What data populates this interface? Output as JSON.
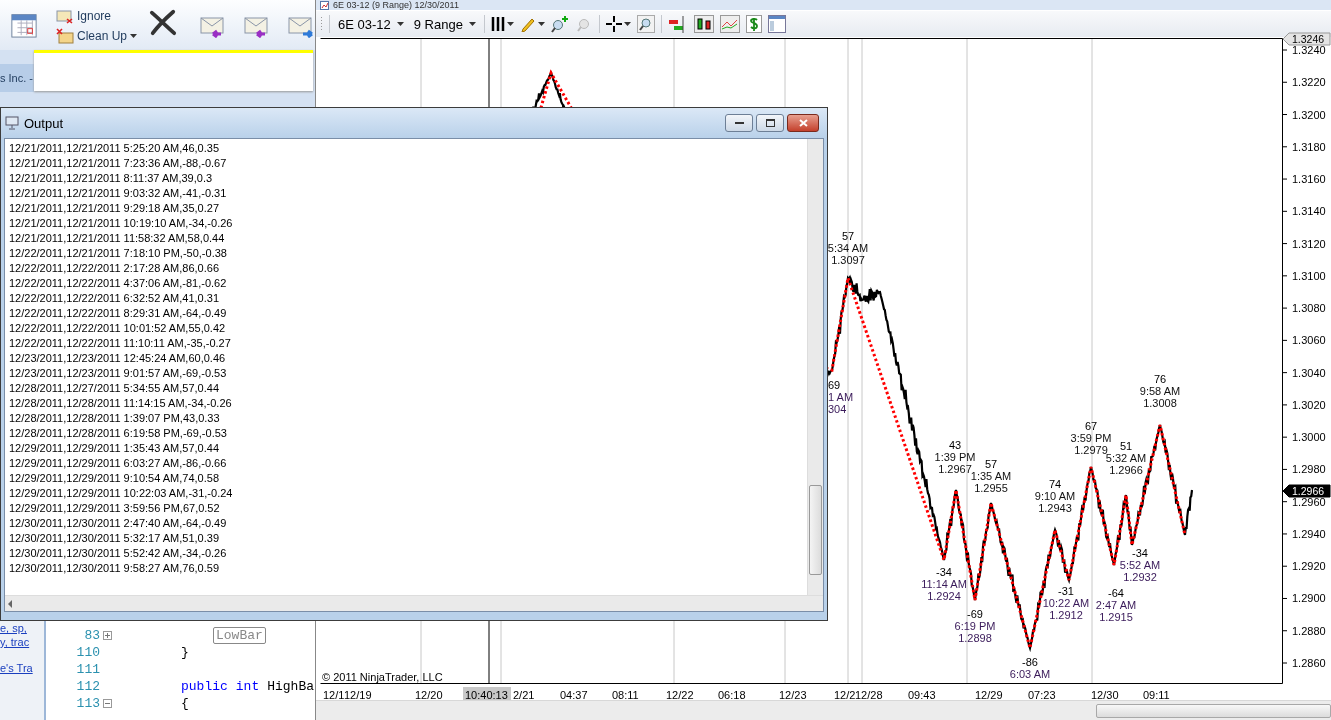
{
  "outlook": {
    "ribbon_buttons": [
      {
        "label": "Ignore",
        "dropdown": false
      },
      {
        "label": "Clean Up",
        "dropdown": true
      }
    ],
    "tab_title": "s Inc. -",
    "links": [
      "e, sp,",
      "y, trac",
      "e's Tra"
    ],
    "code_rows": [
      {
        "number": "83",
        "expanded": false,
        "tokens": [
          {
            "text": "LowBar",
            "kind": "boxed"
          }
        ]
      },
      {
        "number": "110",
        "tokens": [
          {
            "text": "}",
            "kind": "plain"
          }
        ]
      },
      {
        "number": "111"
      },
      {
        "number": "112",
        "tokens": [
          {
            "text": "public",
            "kind": "keyword"
          },
          {
            "text": "int",
            "kind": "keyword"
          },
          {
            "text": "HighBa",
            "kind": "plain"
          }
        ]
      },
      {
        "number": "113",
        "expanded": true,
        "tokens": [
          {
            "text": "{",
            "kind": "plain"
          }
        ]
      }
    ]
  },
  "chart": {
    "title": "6E 03-12 (9 Range) 12/30/2011",
    "toolbar": {
      "instrument": "6E 03-12",
      "period": "9 Range"
    },
    "y_ticks": [
      "1.3240",
      "1.3220",
      "1.3200",
      "1.3180",
      "1.3160",
      "1.3140",
      "1.3120",
      "1.3100",
      "1.3080",
      "1.3060",
      "1.3040",
      "1.3020",
      "1.3000",
      "1.2980",
      "1.2960",
      "1.2940",
      "1.2920",
      "1.2900",
      "1.2880",
      "1.2860"
    ],
    "price_tags": [
      {
        "text": "1.3246",
        "kind": "high"
      },
      {
        "text": "1.2966",
        "kind": "last"
      }
    ],
    "x_labels": [
      {
        "text": "12/1",
        "kind": "date"
      },
      {
        "text": "12/19",
        "kind": "date"
      },
      {
        "text": "12/20",
        "kind": "date"
      },
      {
        "text": "10:40:13",
        "kind": "cursor"
      },
      {
        "text": "2/21",
        "kind": "date"
      },
      {
        "text": "04:37",
        "kind": "time"
      },
      {
        "text": "08:11",
        "kind": "time"
      },
      {
        "text": "12/22",
        "kind": "date"
      },
      {
        "text": "06:18",
        "kind": "time"
      },
      {
        "text": "12/23",
        "kind": "date"
      },
      {
        "text": "12/2",
        "kind": "date"
      },
      {
        "text": "12/28",
        "kind": "date"
      },
      {
        "text": "09:43",
        "kind": "time"
      },
      {
        "text": "12/29",
        "kind": "date"
      },
      {
        "text": "07:23",
        "kind": "time"
      },
      {
        "text": "12/30",
        "kind": "date"
      },
      {
        "text": "09:11",
        "kind": "time"
      }
    ],
    "swings": [
      {
        "kind": "high",
        "lines": [
          "57",
          "5:34 AM",
          "1.3097"
        ]
      },
      {
        "kind": "low",
        "lines": [
          "69",
          "1 AM",
          "304"
        ]
      },
      {
        "kind": "high",
        "lines": [
          "43",
          "1:39 PM",
          "1.2967"
        ]
      },
      {
        "kind": "low",
        "lines": [
          "-34",
          "11:14 AM",
          "1.2924"
        ]
      },
      {
        "kind": "high",
        "lines": [
          "57",
          "1:35 AM",
          "1.2955"
        ]
      },
      {
        "kind": "low",
        "lines": [
          "-69",
          "6:19 PM",
          "1.2898"
        ]
      },
      {
        "kind": "high",
        "lines": [
          "74",
          "9:10 AM",
          "1.2943"
        ]
      },
      {
        "kind": "low",
        "lines": [
          "-86",
          "6:03 AM"
        ]
      },
      {
        "kind": "high",
        "lines": [
          "67",
          "3:59 PM",
          "1.2979"
        ]
      },
      {
        "kind": "low",
        "lines": [
          "-31",
          "10:22 AM",
          "1.2912"
        ]
      },
      {
        "kind": "high",
        "lines": [
          "76",
          "9:58 AM",
          "1.3008"
        ]
      },
      {
        "kind": "high",
        "lines": [
          "51",
          "5:32 AM",
          "1.2966"
        ]
      },
      {
        "kind": "low",
        "lines": [
          "-34",
          "5:52 AM",
          "1.2932"
        ]
      },
      {
        "kind": "low",
        "lines": [
          "-64",
          "2:47 AM",
          "1.2915"
        ]
      }
    ],
    "copyright": "© 2011 NinjaTrader, LLC"
  },
  "output": {
    "title": "Output",
    "lines": [
      "12/21/2011,12/21/2011 5:25:20 AM,46,0.35",
      "12/21/2011,12/21/2011 7:23:36 AM,-88,-0.67",
      "12/21/2011,12/21/2011 8:11:37 AM,39,0.3",
      "12/21/2011,12/21/2011 9:03:32 AM,-41,-0.31",
      "12/21/2011,12/21/2011 9:29:18 AM,35,0.27",
      "12/21/2011,12/21/2011 10:19:10 AM,-34,-0.26",
      "12/21/2011,12/21/2011 11:58:32 AM,58,0.44",
      "12/22/2011,12/21/2011 7:18:10 PM,-50,-0.38",
      "12/22/2011,12/22/2011 2:17:28 AM,86,0.66",
      "12/22/2011,12/22/2011 4:37:06 AM,-81,-0.62",
      "12/22/2011,12/22/2011 6:32:52 AM,41,0.31",
      "12/22/2011,12/22/2011 8:29:31 AM,-64,-0.49",
      "12/22/2011,12/22/2011 10:01:52 AM,55,0.42",
      "12/22/2011,12/22/2011 11:10:11 AM,-35,-0.27",
      "12/23/2011,12/23/2011 12:45:24 AM,60,0.46",
      "12/23/2011,12/23/2011 9:01:57 AM,-69,-0.53",
      "12/28/2011,12/27/2011 5:34:55 AM,57,0.44",
      "12/28/2011,12/28/2011 11:14:15 AM,-34,-0.26",
      "12/28/2011,12/28/2011 1:39:07 PM,43,0.33",
      "12/28/2011,12/28/2011 6:19:58 PM,-69,-0.53",
      "12/29/2011,12/29/2011 1:35:43 AM,57,0.44",
      "12/29/2011,12/29/2011 6:03:27 AM,-86,-0.66",
      "12/29/2011,12/29/2011 9:10:54 AM,74,0.58",
      "12/29/2011,12/29/2011 10:22:03 AM,-31,-0.24",
      "12/29/2011,12/29/2011 3:59:56 PM,67,0.52",
      "12/30/2011,12/30/2011 2:47:40 AM,-64,-0.49",
      "12/30/2011,12/30/2011 5:32:17 AM,51,0.39",
      "12/30/2011,12/30/2011 5:52:42 AM,-34,-0.26",
      "12/30/2011,12/30/2011 9:58:27 AM,76,0.59"
    ]
  }
}
